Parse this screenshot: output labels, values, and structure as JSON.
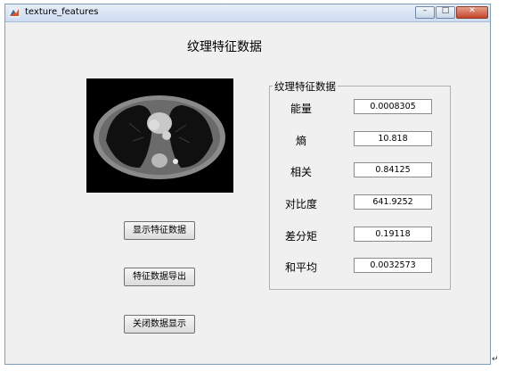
{
  "window": {
    "title": "texture_features",
    "icon": "matlab-figure-icon",
    "controls": {
      "minimize": "–",
      "maximize": "□",
      "close": "✕"
    }
  },
  "heading": "纹理特征数据",
  "image": {
    "description_icon": "ct-scan-image"
  },
  "buttons": {
    "show": "显示特征数据",
    "export": "特征数据导出",
    "close": "关闭数据显示"
  },
  "panel": {
    "title": "纹理特征数据",
    "features": [
      {
        "label": "能量",
        "value": "0.0008305"
      },
      {
        "label": "熵",
        "value": "10.818"
      },
      {
        "label": "相关",
        "value": "0.84125"
      },
      {
        "label": "对比度",
        "value": "641.9252"
      },
      {
        "label": "差分矩",
        "value": "0.19118"
      },
      {
        "label": "和平均",
        "value": "0.0032573"
      }
    ]
  },
  "outer_marker": "↵"
}
